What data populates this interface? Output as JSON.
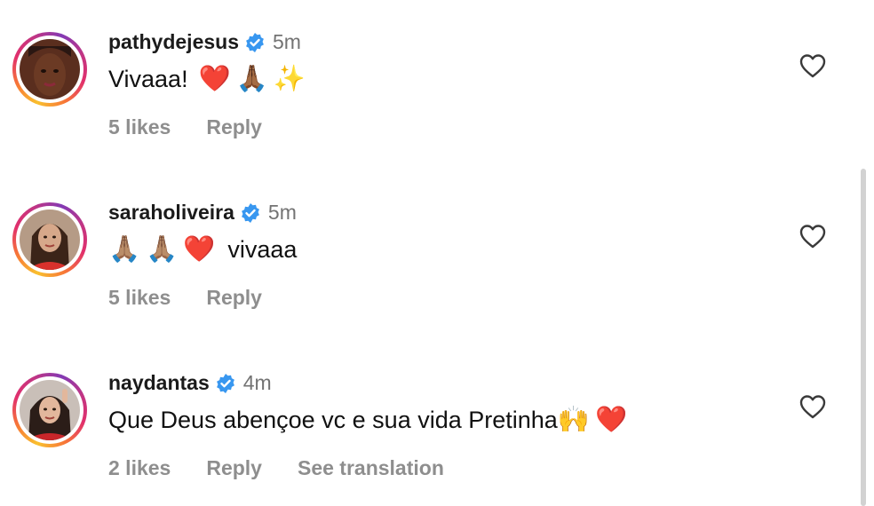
{
  "comments": [
    {
      "username": "pathydejesus",
      "time": "5m",
      "text": "Vivaaa!",
      "emojis": [
        "❤️",
        "🙏🏾",
        "✨"
      ],
      "likes": "5 likes",
      "reply": "Reply",
      "extra": ""
    },
    {
      "username": "saraholiveira",
      "time": "5m",
      "text": "vivaaa",
      "emojis": [
        "🙏🏽",
        "🙏🏽",
        "❤️"
      ],
      "likes": "5 likes",
      "reply": "Reply",
      "extra": ""
    },
    {
      "username": "naydantas",
      "time": "4m",
      "text": "Que Deus abençoe vc e sua vida Pretinha",
      "emojis": [
        "🙌",
        "❤️"
      ],
      "likes": "2 likes",
      "reply": "Reply",
      "extra": "See translation"
    }
  ],
  "colors": {
    "verified": "#3897f0",
    "muted": "#8e8e8e",
    "time": "#737373"
  },
  "icons": {
    "verified": "verified-badge-icon",
    "like": "heart-outline-icon"
  }
}
